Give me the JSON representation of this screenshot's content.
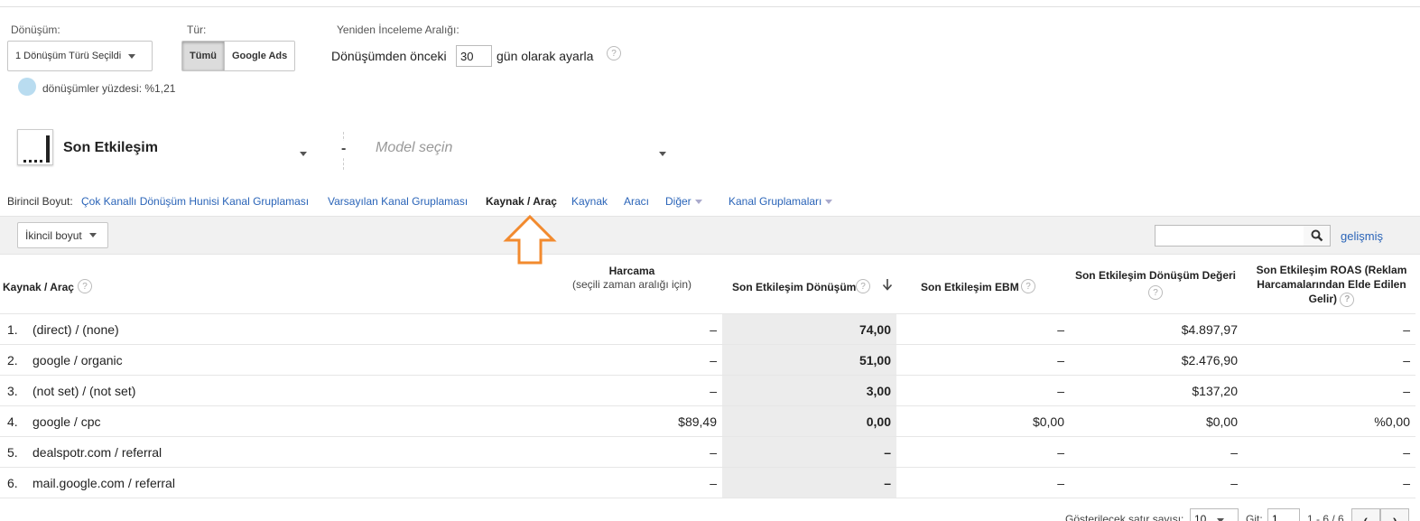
{
  "conversion": {
    "label": "Dönüşüm:",
    "selected": "1 Dönüşüm Türü Seçildi",
    "percentage": "dönüşümler yüzdesi: %1,21"
  },
  "type": {
    "label": "Tür:",
    "options": [
      "Tümü",
      "Google Ads"
    ],
    "selected": "Tümü"
  },
  "lookback": {
    "label": "Yeniden İnceleme Aralığı:",
    "prefix": "Dönüşümden önceki",
    "value": "30",
    "suffix": "gün olarak ayarla",
    "help": "?"
  },
  "model": {
    "primary": "Son Etkileşim",
    "separator": "-",
    "secondary_placeholder": "Model seçin"
  },
  "primary_dimension": {
    "label": "Birincil Boyut:",
    "items": [
      "Çok Kanallı Dönüşüm Hunisi Kanal Gruplaması",
      "Varsayılan Kanal Gruplaması",
      "Kaynak / Araç",
      "Kaynak",
      "Aracı",
      "Diğer",
      "Kanal Gruplamaları"
    ],
    "active": "Kaynak / Araç"
  },
  "secondary_dimension": {
    "label": "İkincil boyut"
  },
  "search": {
    "placeholder": "",
    "advanced": "gelişmiş"
  },
  "table": {
    "headers": {
      "source_medium": "Kaynak / Araç",
      "spend": "Harcama",
      "spend_sub": "(seçili zaman aralığı için)",
      "conversions": "Son Etkileşim Dönüşüm",
      "cpa": "Son Etkileşim EBM",
      "conv_value": "Son Etkileşim Dönüşüm Değeri",
      "roas_line1": "Son Etkileşim ROAS (Reklam",
      "roas_line2": "Harcamalarından Elde Edilen",
      "roas_line3": "Gelir)"
    },
    "rows": [
      {
        "num": "1.",
        "source": "(direct) / (none)",
        "spend": "–",
        "conversions": "74,00",
        "cpa": "–",
        "value": "$4.897,97",
        "roas": "–"
      },
      {
        "num": "2.",
        "source": "google / organic",
        "spend": "–",
        "conversions": "51,00",
        "cpa": "–",
        "value": "$2.476,90",
        "roas": "–"
      },
      {
        "num": "3.",
        "source": "(not set) / (not set)",
        "spend": "–",
        "conversions": "3,00",
        "cpa": "–",
        "value": "$137,20",
        "roas": "–"
      },
      {
        "num": "4.",
        "source": "google / cpc",
        "spend": "$89,49",
        "conversions": "0,00",
        "cpa": "$0,00",
        "value": "$0,00",
        "roas": "%0,00"
      },
      {
        "num": "5.",
        "source": "dealspotr.com / referral",
        "spend": "–",
        "conversions": "–",
        "cpa": "–",
        "value": "–",
        "roas": "–"
      },
      {
        "num": "6.",
        "source": "mail.google.com / referral",
        "spend": "–",
        "conversions": "–",
        "cpa": "–",
        "value": "–",
        "roas": "–"
      }
    ]
  },
  "footer": {
    "rows_label": "Gösterilecek satır sayısı:",
    "rows_value": "10",
    "goto_label": "Git:",
    "goto_value": "1",
    "range": "1 - 6 / 6"
  },
  "colors": {
    "link": "#2a64b8",
    "arrow": "#f28a2e"
  }
}
